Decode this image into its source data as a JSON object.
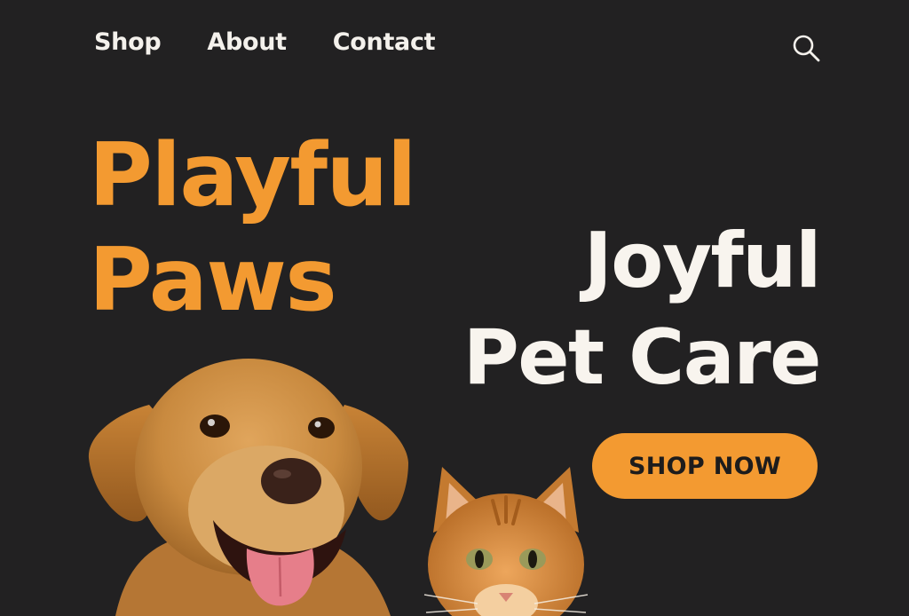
{
  "nav": {
    "items": [
      "Shop",
      "About",
      "Contact"
    ],
    "search_icon": "search-icon"
  },
  "brand": {
    "line1": "Playful",
    "line2": "Paws",
    "color": "#f39a31"
  },
  "hero": {
    "tagline_line1": "Joyful",
    "tagline_line2": "Pet Care",
    "cta_label": "SHOP NOW"
  },
  "images": {
    "dog": "golden-retriever-photo",
    "cat": "orange-tabby-cat-photo"
  },
  "colors": {
    "background": "#222122",
    "accent": "#f39a31",
    "text": "#f8f4ee"
  }
}
